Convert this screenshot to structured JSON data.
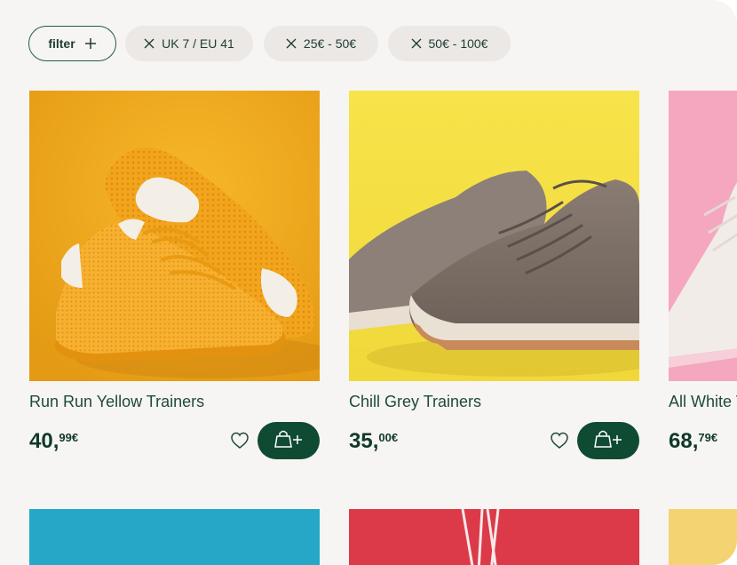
{
  "filters": {
    "filter_label": "filter",
    "active": [
      {
        "label": "UK 7 / EU 41"
      },
      {
        "label": "25€ - 50€"
      },
      {
        "label": "50€ - 100€"
      }
    ]
  },
  "products": [
    {
      "name": "Run Run Yellow Trainers",
      "price_int": "40,",
      "price_dec": "99€"
    },
    {
      "name": "Chill Grey Trainers",
      "price_int": "35,",
      "price_dec": "00€"
    },
    {
      "name": "All White Trainers",
      "price_int": "68,",
      "price_dec": "79€"
    }
  ],
  "icons": {
    "filter_add": "plus-icon",
    "chip_remove": "close-icon",
    "wishlist": "heart-icon",
    "add_to_cart": "shopping-bag-plus-icon"
  },
  "colors": {
    "accent": "#0f4a33",
    "background": "#f7f5f3",
    "chip": "#ebe8e5",
    "text": "#1f4a3a"
  }
}
